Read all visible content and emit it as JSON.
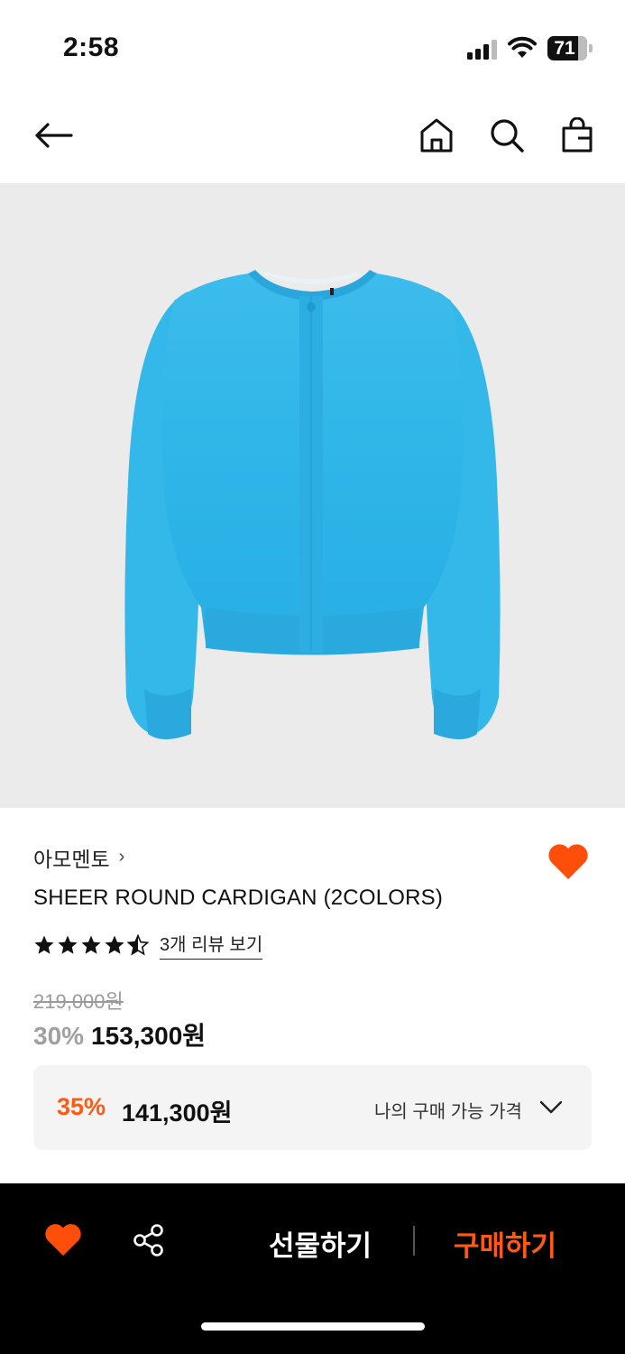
{
  "status_bar": {
    "time": "2:58",
    "battery_level": "71"
  },
  "nav": {
    "back_icon": "arrow-left-icon",
    "home_icon": "home-icon",
    "search_icon": "search-icon",
    "cart_icon": "shopping-bag-icon"
  },
  "product": {
    "brand": "아모멘토",
    "brand_chevron": "›",
    "name": "SHEER ROUND CARDIGAN (2COLORS)",
    "rating": 4.5,
    "review_link": "3개 리뷰 보기",
    "original_price": "219,000원",
    "discount_rate": "30%",
    "sale_price": "153,300원",
    "image_color": "#33b8ea"
  },
  "my_price": {
    "rate": "35%",
    "price": "141,300원",
    "label": "나의 구매 가능 가격"
  },
  "bottom_bar": {
    "gift_label": "선물하기",
    "buy_label": "구매하기"
  },
  "colors": {
    "accent": "#ff5a14",
    "wish": "#ff4d0a"
  }
}
